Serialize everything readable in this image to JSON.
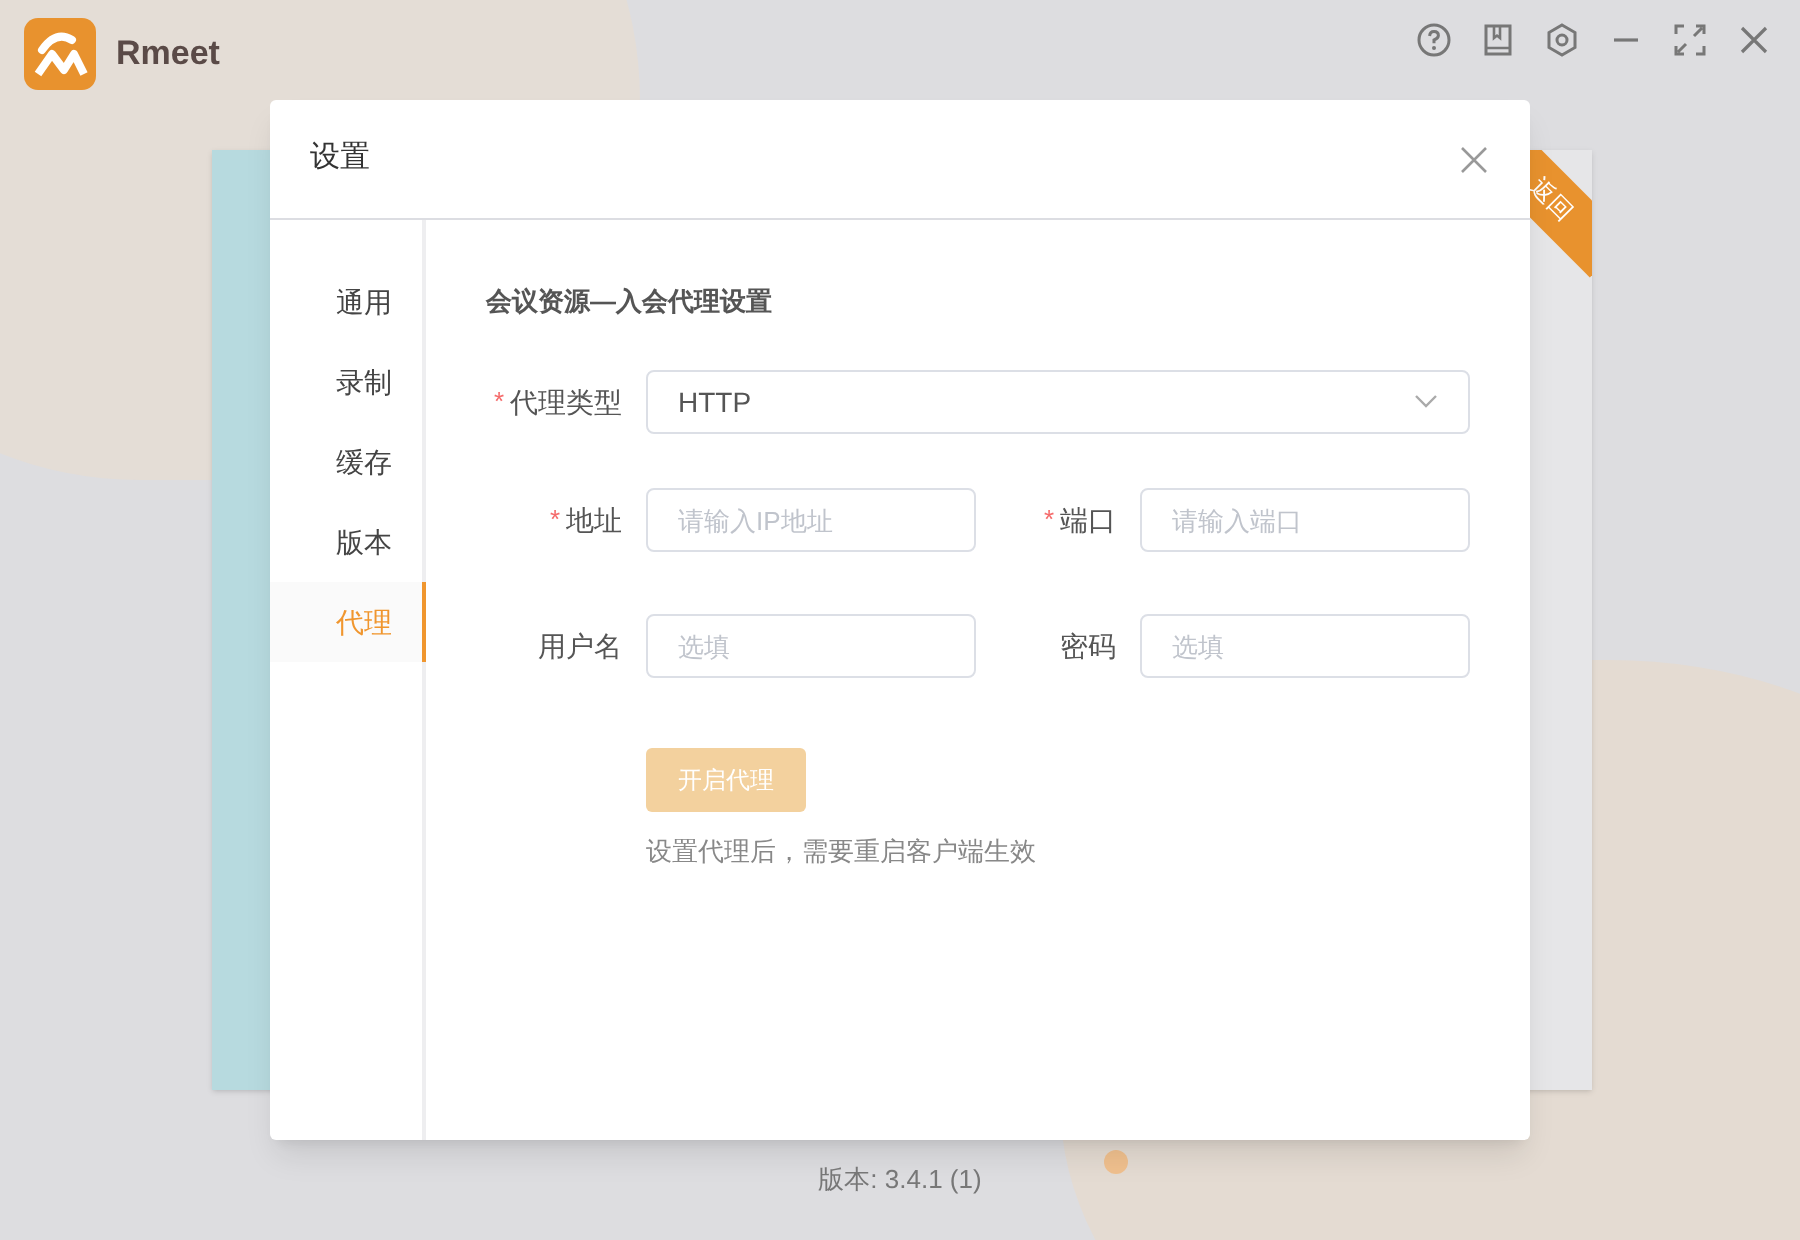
{
  "app": {
    "name": "Rmeet"
  },
  "back_ribbon": "返回",
  "dialog": {
    "title": "设置",
    "sidebar": [
      {
        "label": "通用",
        "selected": false
      },
      {
        "label": "录制",
        "selected": false
      },
      {
        "label": "缓存",
        "selected": false
      },
      {
        "label": "版本",
        "selected": false
      },
      {
        "label": "代理",
        "selected": true
      }
    ],
    "section_title": "会议资源—入会代理设置",
    "proxy_type": {
      "required_mark": "*",
      "label": "代理类型",
      "value": "HTTP"
    },
    "rows": [
      [
        {
          "required_mark": "*",
          "label": "地址",
          "placeholder": "请输入IP地址"
        },
        {
          "required_mark": "*",
          "label": "端口",
          "placeholder": "请输入端口"
        }
      ],
      [
        {
          "label": "用户名",
          "placeholder": "选填"
        },
        {
          "label": "密码",
          "placeholder": "选填"
        }
      ]
    ],
    "enable_button": {
      "label": "开启代理",
      "disabled": true
    },
    "note": "设置代理后，需要重启客户端生效"
  },
  "version": "版本: 3.4.1 (1)"
}
